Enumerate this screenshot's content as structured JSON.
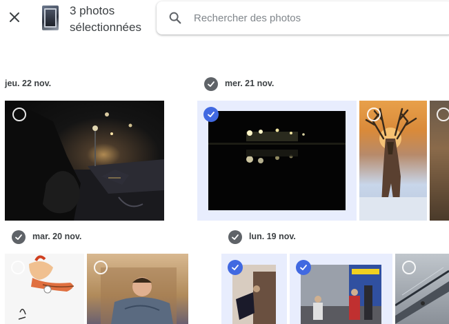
{
  "header": {
    "close_icon": "close-icon",
    "selection_count": "3 photos sélectionnées"
  },
  "search": {
    "placeholder": "Rechercher des photos",
    "icon": "search-icon"
  },
  "groups": [
    {
      "date": "jeu. 22 nov.",
      "selected": false
    },
    {
      "date": "mer. 21 nov.",
      "selected": true
    },
    {
      "date": "mar. 20 nov.",
      "selected": true
    },
    {
      "date": "lun. 19 nov.",
      "selected": true
    }
  ],
  "colors": {
    "accent": "#4169e1",
    "selected_background": "#e8edfd",
    "date_check": "#5f6368"
  }
}
